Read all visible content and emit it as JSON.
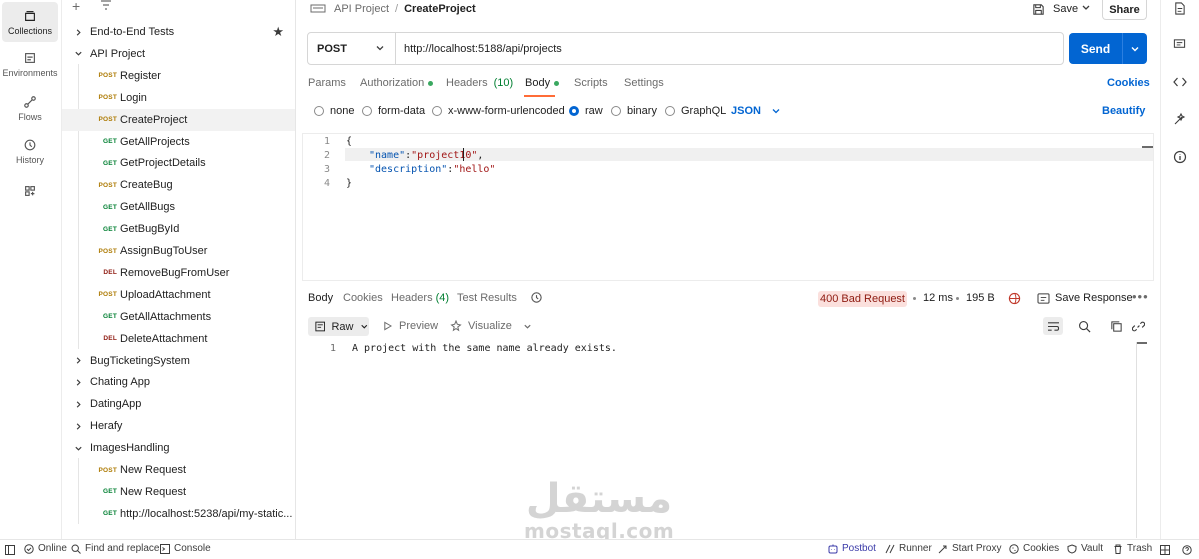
{
  "rail": {
    "items": [
      {
        "label": "Collections",
        "icon": "collections-icon"
      },
      {
        "label": "Environments",
        "icon": "environments-icon"
      },
      {
        "label": "Flows",
        "icon": "flows-icon"
      },
      {
        "label": "History",
        "icon": "history-icon"
      },
      {
        "label": "",
        "icon": "configure-sidebar-icon"
      }
    ]
  },
  "sidebar": {
    "tree": [
      {
        "type": "folder",
        "label": "End-to-End Tests",
        "expanded": false,
        "starred": true
      },
      {
        "type": "folder",
        "label": "API Project",
        "expanded": true
      },
      {
        "type": "request",
        "method": "POST",
        "label": "Register"
      },
      {
        "type": "request",
        "method": "POST",
        "label": "Login"
      },
      {
        "type": "request",
        "method": "POST",
        "label": "CreateProject",
        "selected": true
      },
      {
        "type": "request",
        "method": "GET",
        "label": "GetAllProjects"
      },
      {
        "type": "request",
        "method": "GET",
        "label": "GetProjectDetails"
      },
      {
        "type": "request",
        "method": "POST",
        "label": "CreateBug"
      },
      {
        "type": "request",
        "method": "GET",
        "label": "GetAllBugs"
      },
      {
        "type": "request",
        "method": "GET",
        "label": "GetBugById"
      },
      {
        "type": "request",
        "method": "POST",
        "label": "AssignBugToUser"
      },
      {
        "type": "request",
        "method": "DEL",
        "label": "RemoveBugFromUser"
      },
      {
        "type": "request",
        "method": "POST",
        "label": "UploadAttachment"
      },
      {
        "type": "request",
        "method": "GET",
        "label": "GetAllAttachments"
      },
      {
        "type": "request",
        "method": "DEL",
        "label": "DeleteAttachment"
      },
      {
        "type": "folder",
        "label": "BugTicketingSystem",
        "expanded": false
      },
      {
        "type": "folder",
        "label": "Chating App",
        "expanded": false
      },
      {
        "type": "folder",
        "label": "DatingApp",
        "expanded": false
      },
      {
        "type": "folder",
        "label": "Herafy",
        "expanded": false
      },
      {
        "type": "folder",
        "label": "ImagesHandling",
        "expanded": true
      },
      {
        "type": "request",
        "method": "POST",
        "label": "New Request"
      },
      {
        "type": "request",
        "method": "GET",
        "label": "New Request"
      },
      {
        "type": "request",
        "method": "GET",
        "label": "http://localhost:5238/api/my-static..."
      }
    ]
  },
  "tab": {
    "breadcrumb_parent": "API Project",
    "breadcrumb_sep": "/",
    "breadcrumb_current": "CreateProject",
    "save_label": "Save",
    "share_label": "Share"
  },
  "request": {
    "method": "POST",
    "url": "http://localhost:5188/api/projects",
    "send_label": "Send",
    "tabs": [
      {
        "label": "Params"
      },
      {
        "label": "Authorization",
        "dot": true
      },
      {
        "label": "Headers",
        "count": "(10)"
      },
      {
        "label": "Body",
        "dot": true,
        "active": true
      },
      {
        "label": "Scripts"
      },
      {
        "label": "Settings"
      }
    ],
    "cookies_label": "Cookies",
    "body_types": [
      "none",
      "form-data",
      "x-www-form-urlencoded",
      "raw",
      "binary",
      "GraphQL"
    ],
    "selected_body_type": "raw",
    "format": "JSON",
    "beautify_label": "Beautify",
    "code_lines": [
      "1",
      "2",
      "3",
      "4"
    ],
    "code": {
      "open": "{",
      "key1": "\"name\"",
      "val1": "\"project10\"",
      "key2": "\"description\"",
      "val2": "\"hello\"",
      "close": "}"
    }
  },
  "response": {
    "tabs": [
      {
        "label": "Body",
        "active": true
      },
      {
        "label": "Cookies"
      },
      {
        "label": "Headers",
        "count": "(4)"
      },
      {
        "label": "Test Results"
      }
    ],
    "status": "400 Bad Request",
    "time": "12 ms",
    "size": "195 B",
    "save_response_label": "Save Response",
    "view_mode": "Raw",
    "preview_label": "Preview",
    "visualize_label": "Visualize",
    "line_no": "1",
    "text": "A project with the same name already exists."
  },
  "statusbar": {
    "online": "Online",
    "find_replace": "Find and replace",
    "console": "Console",
    "postbot": "Postbot",
    "runner": "Runner",
    "start_proxy": "Start Proxy",
    "cookies": "Cookies",
    "vault": "Vault",
    "trash": "Trash"
  },
  "watermark": {
    "arabic": "مستقل",
    "latin": "mostaql.com"
  },
  "colors": {
    "accent": "#0265d2",
    "tab_indicator": "#ff6c37",
    "post": "#ad7a03",
    "get": "#007f31",
    "del": "#8e1a10",
    "error_bg": "#fbe0dd"
  }
}
